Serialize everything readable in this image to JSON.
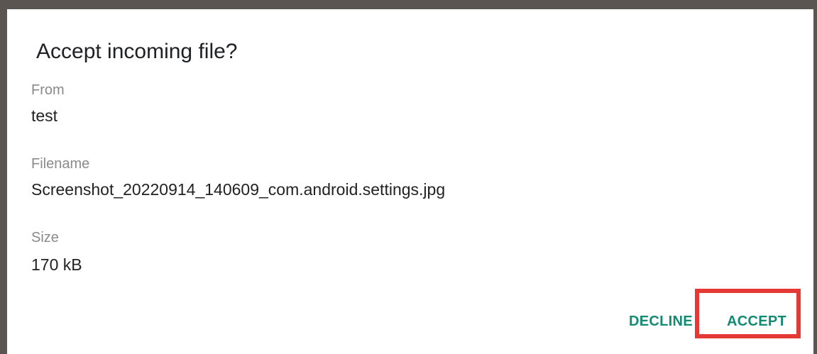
{
  "dialog": {
    "title": "Accept incoming file?",
    "fields": [
      {
        "label": "From",
        "value": "test"
      },
      {
        "label": "Filename",
        "value": "Screenshot_20220914_140609_com.android.settings.jpg"
      },
      {
        "label": "Size",
        "value": "170 kB"
      }
    ],
    "buttons": {
      "decline": "DECLINE",
      "accept": "ACCEPT"
    }
  },
  "colors": {
    "accent": "#138a72",
    "highlight": "#e53935"
  }
}
